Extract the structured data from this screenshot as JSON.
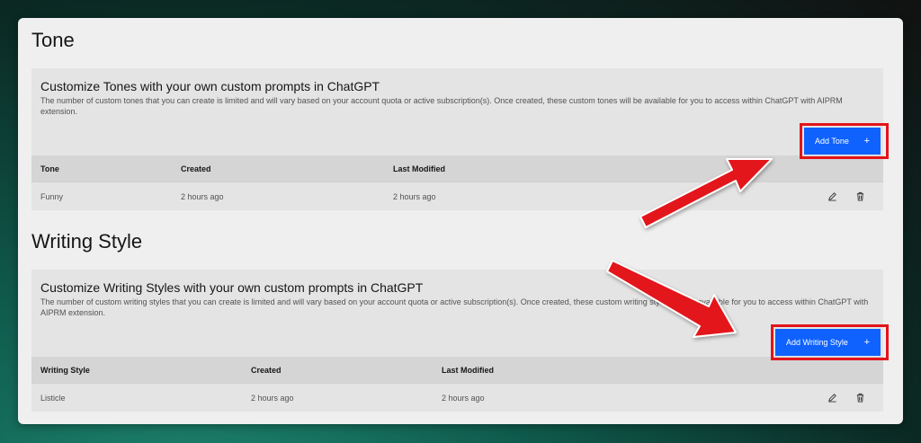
{
  "tone": {
    "section_title": "Tone",
    "card_title": "Customize Tones with your own custom prompts in ChatGPT",
    "description": "The number of custom tones that you can create is limited and will vary based on your account quota or active subscription(s). Once created, these custom tones will be available for you to access within ChatGPT with AIPRM extension.",
    "add_button": "Add Tone",
    "columns": [
      "Tone",
      "Created",
      "Last Modified"
    ],
    "rows": [
      {
        "name": "Funny",
        "created": "2 hours ago",
        "modified": "2 hours ago"
      }
    ]
  },
  "writing_style": {
    "section_title": "Writing Style",
    "card_title": "Customize Writing Styles with your own custom prompts in ChatGPT",
    "description": "The number of custom writing styles that you can create is limited and will vary based on your account quota or active subscription(s). Once created, these custom writing styles will be available for you to access within ChatGPT with AIPRM extension.",
    "add_button": "Add Writing Style",
    "columns": [
      "Writing Style",
      "Created",
      "Last Modified"
    ],
    "rows": [
      {
        "name": "Listicle",
        "created": "2 hours ago",
        "modified": "2 hours ago"
      }
    ]
  },
  "icons": {
    "add": "plus-icon",
    "edit": "pencil-icon",
    "delete": "trash-icon"
  },
  "colors": {
    "primary": "#0f62fe",
    "annotation": "#e3141a"
  },
  "plus_glyph": "+"
}
